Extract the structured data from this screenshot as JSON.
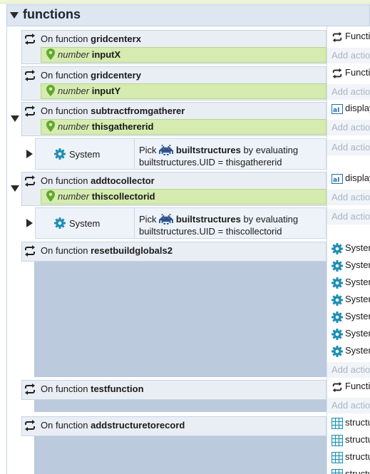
{
  "group": {
    "title": "functions"
  },
  "events": [
    {
      "keyword": "On function",
      "name": "gridcenterx",
      "param": {
        "type": "number",
        "name": "inputX"
      },
      "action_label": "Function",
      "add_action": "Add action"
    },
    {
      "keyword": "On function",
      "name": "gridcentery",
      "param": {
        "type": "number",
        "name": "inputY"
      },
      "action_label": "Function",
      "add_action": "Add action"
    },
    {
      "keyword": "On function",
      "name": "subtractfromgatherer",
      "param": {
        "type": "number",
        "name": "thisgathererid"
      },
      "action_label": "display",
      "add_action": "Add action",
      "sub": {
        "object": "System",
        "pick": "Pick",
        "target": "builtstructures",
        "by": "by evaluating",
        "expression": "builtstructures.UID = thisgathererid",
        "add_action": "Add action"
      }
    },
    {
      "keyword": "On function",
      "name": "addtocollector",
      "param": {
        "type": "number",
        "name": "thiscollectorid"
      },
      "action_label": "display",
      "add_action": "Add action",
      "sub": {
        "object": "System",
        "pick": "Pick",
        "target": "builtstructures",
        "by": "by evaluating",
        "expression": "builtstructures.UID = thiscollectorid",
        "add_action": "Add action"
      }
    },
    {
      "keyword": "On function",
      "name": "resetbuildglobals2",
      "actions": [
        "System",
        "System",
        "System",
        "System",
        "System",
        "System",
        "System"
      ],
      "add_action": "Add action"
    },
    {
      "keyword": "On function",
      "name": "testfunction",
      "action_label": "Function",
      "add_action": "Add action"
    },
    {
      "keyword": "On function",
      "name": "addstructuretorecord",
      "actions": [
        "structu",
        "structu",
        "structu",
        "structu"
      ]
    }
  ],
  "colors": {
    "header_bg": "#dde6f1",
    "param_bg": "#d5ebb0",
    "param_icon": "#5fa82d",
    "gear": "#1f8fb3",
    "body_bg": "#bccadd"
  },
  "icons": {
    "event": "loop-arrows-icon",
    "param": "location-pin-icon",
    "system": "gear-icon",
    "sprite": "invader-sprite-icon",
    "text": "text-object-icon",
    "array": "grid-table-icon"
  }
}
